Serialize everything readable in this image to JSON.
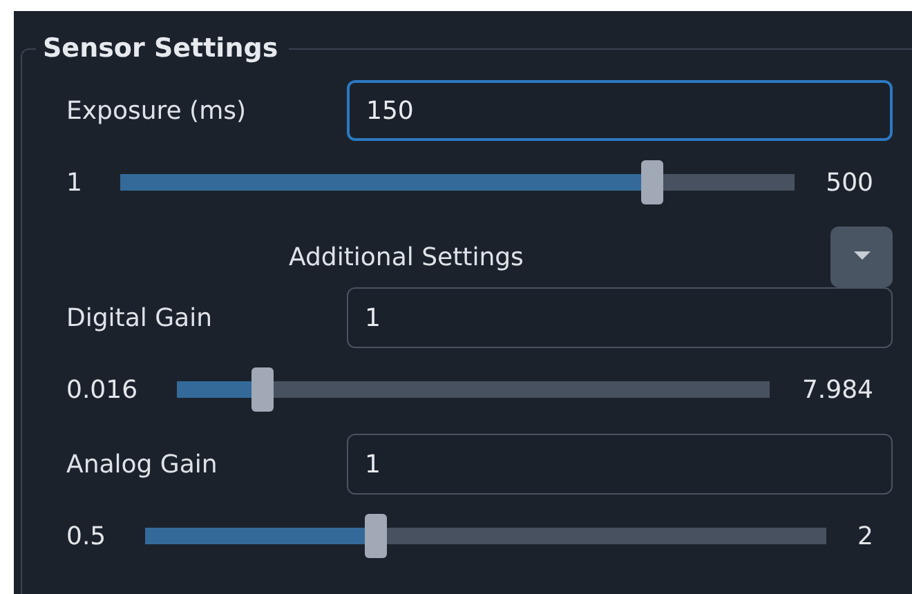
{
  "group": {
    "title": "Sensor Settings"
  },
  "exposure": {
    "label": "Exposure (ms)",
    "value": "150",
    "focused": true,
    "slider": {
      "min": "1",
      "max": "500",
      "level": 0.79
    }
  },
  "additional": {
    "label": "Additional Settings",
    "expanded": true
  },
  "settings": [
    {
      "label": "Digital Gain",
      "value": "1",
      "focused": false,
      "slider": {
        "min": "0.016",
        "max": "7.984",
        "level": 0.145
      }
    },
    {
      "label": "Analog Gain",
      "value": "1",
      "focused": false,
      "slider": {
        "min": "0.5",
        "max": "2",
        "level": 0.34
      }
    }
  ]
}
